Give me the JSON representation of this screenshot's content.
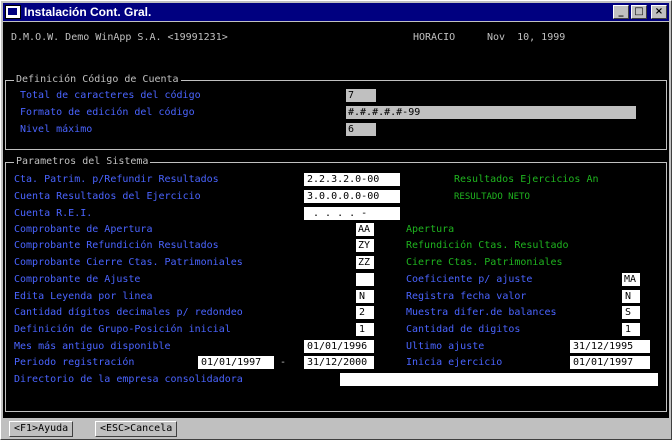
{
  "window": {
    "title": "Instalación Cont. Gral.",
    "min_glyph": "_",
    "max_glyph": "□",
    "close_glyph": "×"
  },
  "header": {
    "company": "D.M.O.W. Demo WinApp S.A. <19991231>",
    "user": "HORACIO",
    "date": "Nov  10, 1999"
  },
  "codigo": {
    "title": "Definición Código de Cuenta",
    "total_label": "Total de caracteres del código",
    "total_value": "7",
    "formato_label": "Formato de edición del código",
    "formato_value": "#.#.#.#.#-99",
    "nivel_label": "Nivel máximo",
    "nivel_value": "6"
  },
  "sistema": {
    "title": "Parametros del Sistema",
    "cta_refundir_label": "Cta. Patrim. p/Refundir Resultados",
    "cta_refundir_value": "2.2.3.2.0-00",
    "cta_refundir_desc": "Resultados Ejercicios An",
    "cta_resultados_label": "Cuenta Resultados del Ejercicio",
    "cta_resultados_value": "3.0.0.0.0-00",
    "cta_resultados_desc": "RESULTADO NETO",
    "cta_rei_label": "Cuenta R.E.I.",
    "cta_rei_value": " . . . . -",
    "comp_apertura_label": "Comprobante de Apertura",
    "comp_apertura_value": "AA",
    "comp_apertura_desc": "Apertura",
    "comp_refundicion_label": "Comprobante Refundición Resultados",
    "comp_refundicion_value": "ZY",
    "comp_refundicion_desc": "Refundición Ctas. Resultado",
    "comp_cierre_label": "Comprobante Cierre Ctas. Patrimoniales",
    "comp_cierre_value": "ZZ",
    "comp_cierre_desc": "Cierre Ctas. Patrimoniales",
    "comp_ajuste_label": "Comprobante de Ajuste",
    "comp_ajuste_value": "",
    "coef_ajuste_label": "Coeficiente p/ ajuste",
    "coef_ajuste_value": "MA",
    "edita_leyenda_label": "Edita Leyenda por linea",
    "edita_leyenda_value": "N",
    "registra_fecha_label": "Registra fecha valor",
    "registra_fecha_value": "N",
    "cant_decimales_label": "Cantidad dígitos decimales p/ redondeo",
    "cant_decimales_value": "2",
    "muestra_difer_label": "Muestra difer.de balances",
    "muestra_difer_value": "S",
    "grupo_posicion_label": "Definición de Grupo-Posición inicial",
    "grupo_posicion_value": "1",
    "cant_digitos_label": "Cantidad de digitos",
    "cant_digitos_value": "1",
    "mes_antiguo_label": "Mes más antiguo disponible",
    "mes_antiguo_value": "01/01/1996",
    "ultimo_ajuste_label": "Ultimo ajuste",
    "ultimo_ajuste_value": "31/12/1995",
    "periodo_label": "Periodo registración",
    "periodo_desde": "01/01/1997",
    "periodo_sep": "-",
    "periodo_hasta": "31/12/2000",
    "inicia_ejercicio_label": "Inicia ejercicio",
    "inicia_ejercicio_value": "01/01/1997",
    "directorio_label": "Directorio de la empresa consolidadora",
    "directorio_value": ""
  },
  "statusbar": {
    "ayuda": "<F1>Ayuda",
    "cancela": "<ESC>Cancela"
  }
}
